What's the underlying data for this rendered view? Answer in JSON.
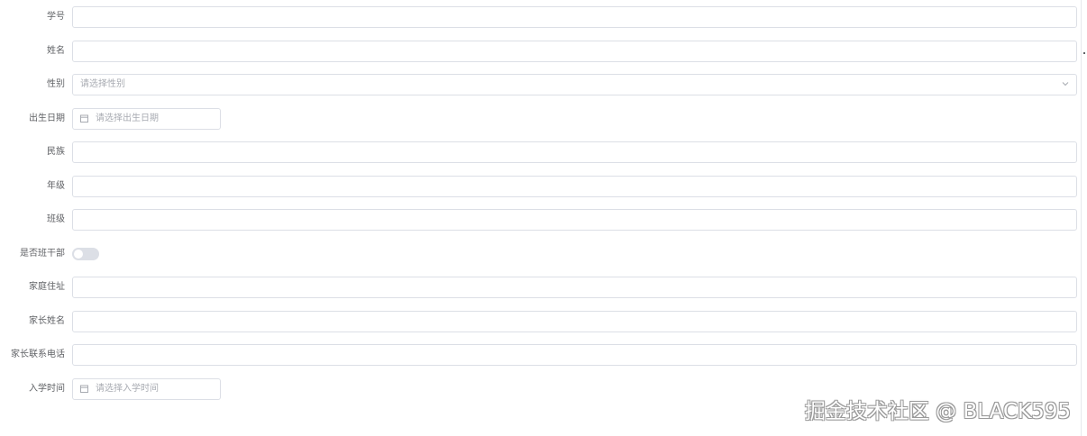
{
  "form": {
    "student_id": {
      "label": "学号",
      "value": ""
    },
    "name": {
      "label": "姓名",
      "value": ""
    },
    "gender": {
      "label": "性别",
      "placeholder": "请选择性别"
    },
    "birth_date": {
      "label": "出生日期",
      "placeholder": "请选择出生日期"
    },
    "ethnicity": {
      "label": "民族",
      "value": ""
    },
    "grade": {
      "label": "年级",
      "value": ""
    },
    "class": {
      "label": "班级",
      "value": ""
    },
    "is_class_cadre": {
      "label": "是否班干部",
      "on": false
    },
    "home_address": {
      "label": "家庭住址",
      "value": ""
    },
    "parent_name": {
      "label": "家长姓名",
      "value": ""
    },
    "parent_phone": {
      "label": "家长联系电话",
      "value": ""
    },
    "enrollment_date": {
      "label": "入学时间",
      "placeholder": "请选择入学时间"
    }
  },
  "watermark": {
    "text": "掘金技术社区 @ BLACK595"
  },
  "icons": {
    "dropdown": "chevron-down-icon",
    "calendar": "calendar-icon"
  },
  "colors": {
    "border": "#dcdfe6",
    "label": "#606266",
    "placeholder": "#a8abb2",
    "switch_off": "#dcdfe6"
  }
}
